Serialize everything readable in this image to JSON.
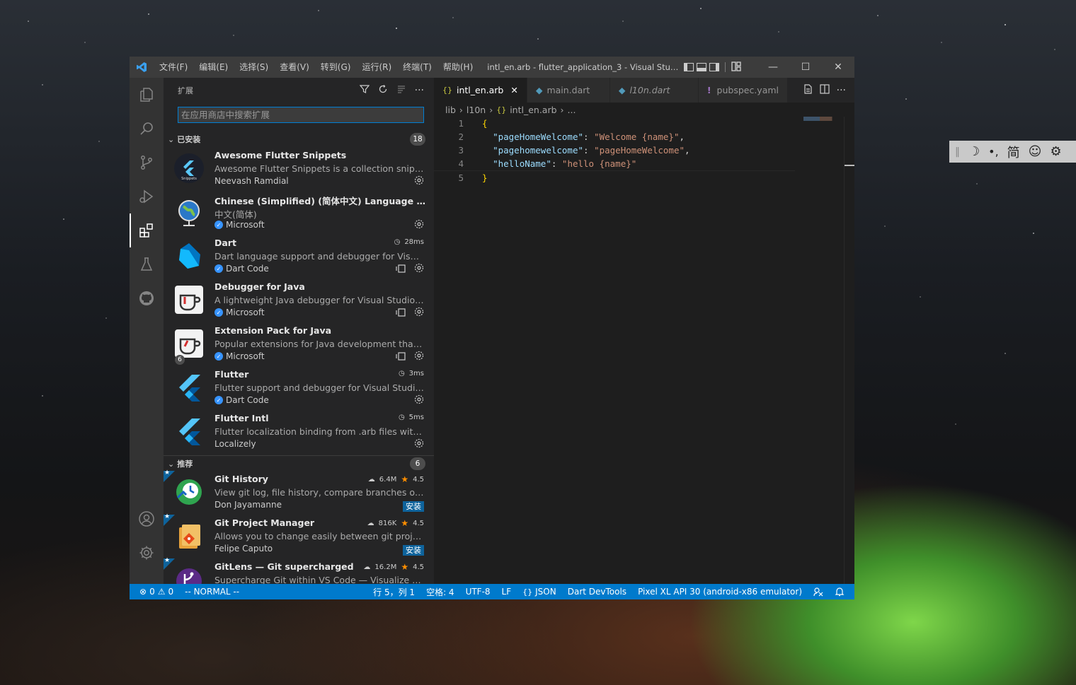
{
  "titlebar": {
    "menus": [
      "文件(F)",
      "编辑(E)",
      "选择(S)",
      "查看(V)",
      "转到(G)",
      "运行(R)",
      "终端(T)",
      "帮助(H)"
    ],
    "window_title": "intl_en.arb - flutter_application_3 - Visual Studio C...",
    "controls": {
      "minimize": "—",
      "maximize": "☐",
      "close": "✕"
    }
  },
  "sidebar": {
    "title": "扩展",
    "search_placeholder": "在应用商店中搜索扩展",
    "installed": {
      "label": "已安装",
      "count": "18",
      "items": [
        {
          "name": "Awesome Flutter Snippets",
          "desc": "Awesome Flutter Snippets is a collection snippets ...",
          "publisher": "Neevash Ramdial",
          "verified": false,
          "time": ""
        },
        {
          "name": "Chinese (Simplified) (简体中文) Language Pack ...",
          "desc": "中文(简体)",
          "publisher": "Microsoft",
          "verified": true,
          "time": ""
        },
        {
          "name": "Dart",
          "desc": "Dart language support and debugger for Visual St...",
          "publisher": "Dart Code",
          "verified": true,
          "time": "28ms"
        },
        {
          "name": "Debugger for Java",
          "desc": "A lightweight Java debugger for Visual Studio Code",
          "publisher": "Microsoft",
          "verified": true,
          "time": ""
        },
        {
          "name": "Extension Pack for Java",
          "desc": "Popular extensions for Java development that pro...",
          "publisher": "Microsoft",
          "verified": true,
          "time": "",
          "badge": "6"
        },
        {
          "name": "Flutter",
          "desc": "Flutter support and debugger for Visual Studio Co...",
          "publisher": "Dart Code",
          "verified": true,
          "time": "3ms"
        },
        {
          "name": "Flutter Intl",
          "desc": "Flutter localization binding from .arb files with offi...",
          "publisher": "Localizely",
          "verified": false,
          "time": "5ms"
        }
      ]
    },
    "recommended": {
      "label": "推荐",
      "count": "6",
      "install_label": "安装",
      "items": [
        {
          "name": "Git History",
          "desc": "View git log, file history, compare branches or co...",
          "publisher": "Don Jayamanne",
          "downloads": "6.4M",
          "rating": "4.5"
        },
        {
          "name": "Git Project Manager",
          "desc": "Allows you to change easily between git projects.",
          "publisher": "Felipe Caputo",
          "downloads": "816K",
          "rating": "4.5"
        },
        {
          "name": "GitLens — Git supercharged",
          "desc": "Supercharge Git within VS Code — Visualize code ...",
          "publisher": "",
          "downloads": "16.2M",
          "rating": "4.5"
        }
      ]
    }
  },
  "editor": {
    "tabs": [
      {
        "label": "intl_en.arb",
        "active": true
      },
      {
        "label": "main.dart",
        "active": false
      },
      {
        "label": "l10n.dart",
        "active": false
      },
      {
        "label": "pubspec.yaml",
        "active": false
      }
    ],
    "breadcrumb": [
      "lib",
      "l10n",
      "intl_en.arb",
      "..."
    ],
    "line_numbers": [
      "1",
      "2",
      "3",
      "4",
      "5"
    ],
    "code": {
      "open": "{",
      "close": "}",
      "entries": [
        {
          "key": "\"pageHomeWelcome\"",
          "value": "\"Welcome {name}\"",
          "comma": ","
        },
        {
          "key": "\"pagehomewelcome\"",
          "value": "\"pageHomeWelcome\"",
          "comma": ","
        },
        {
          "key": "\"helloName\"",
          "value": "\"hello {name}\"",
          "comma": ""
        }
      ]
    }
  },
  "statusbar": {
    "errors": "0",
    "warnings": "0",
    "mode": "-- NORMAL --",
    "position": "行 5，列 1",
    "spaces": "空格: 4",
    "encoding": "UTF-8",
    "eol": "LF",
    "language": "JSON",
    "devtools": "Dart DevTools",
    "device": "Pixel XL API 30 (android-x86 emulator)"
  },
  "ime": {
    "mode_char": "简"
  },
  "colors": {
    "accent": "#007acc",
    "titlebar": "#3c3c3c",
    "sidebar": "#252526",
    "editor": "#1e1e1e",
    "activitybar": "#333333"
  }
}
